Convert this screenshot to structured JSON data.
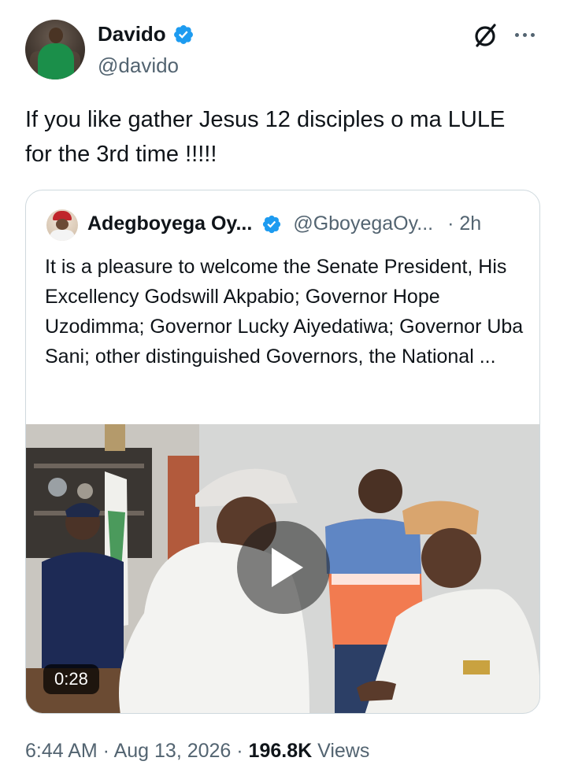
{
  "author": {
    "display_name": "Davido",
    "handle": "@davido"
  },
  "tweet": {
    "text": "If you like gather Jesus 12 disciples o ma LULE for the 3rd time !!!!!"
  },
  "quoted": {
    "display_name": "Adegboyega Oy...",
    "handle": "@GboyegaOy...",
    "time": "· 2h",
    "text": "It is a pleasure to welcome the Senate President, His Excellency Godswill Akpabio; Governor Hope Uzodimma; Governor Lucky Aiyedatiwa; Governor Uba Sani; other distinguished Governors, the National ...",
    "video": {
      "duration": "0:28"
    }
  },
  "meta": {
    "time": "6:44 AM",
    "sep1": " · ",
    "date": "Aug 13, 2026",
    "sep2": " · ",
    "views_count": "196.8K",
    "views_label": " Views"
  },
  "icons": {
    "verified": "verified-badge-icon",
    "grok": "grok-icon",
    "more": "more-options-icon",
    "play": "play-icon"
  },
  "colors": {
    "verified_blue": "#1d9bf0",
    "text_primary": "#0f1419",
    "text_secondary": "#536471",
    "border": "#cfd9de"
  }
}
